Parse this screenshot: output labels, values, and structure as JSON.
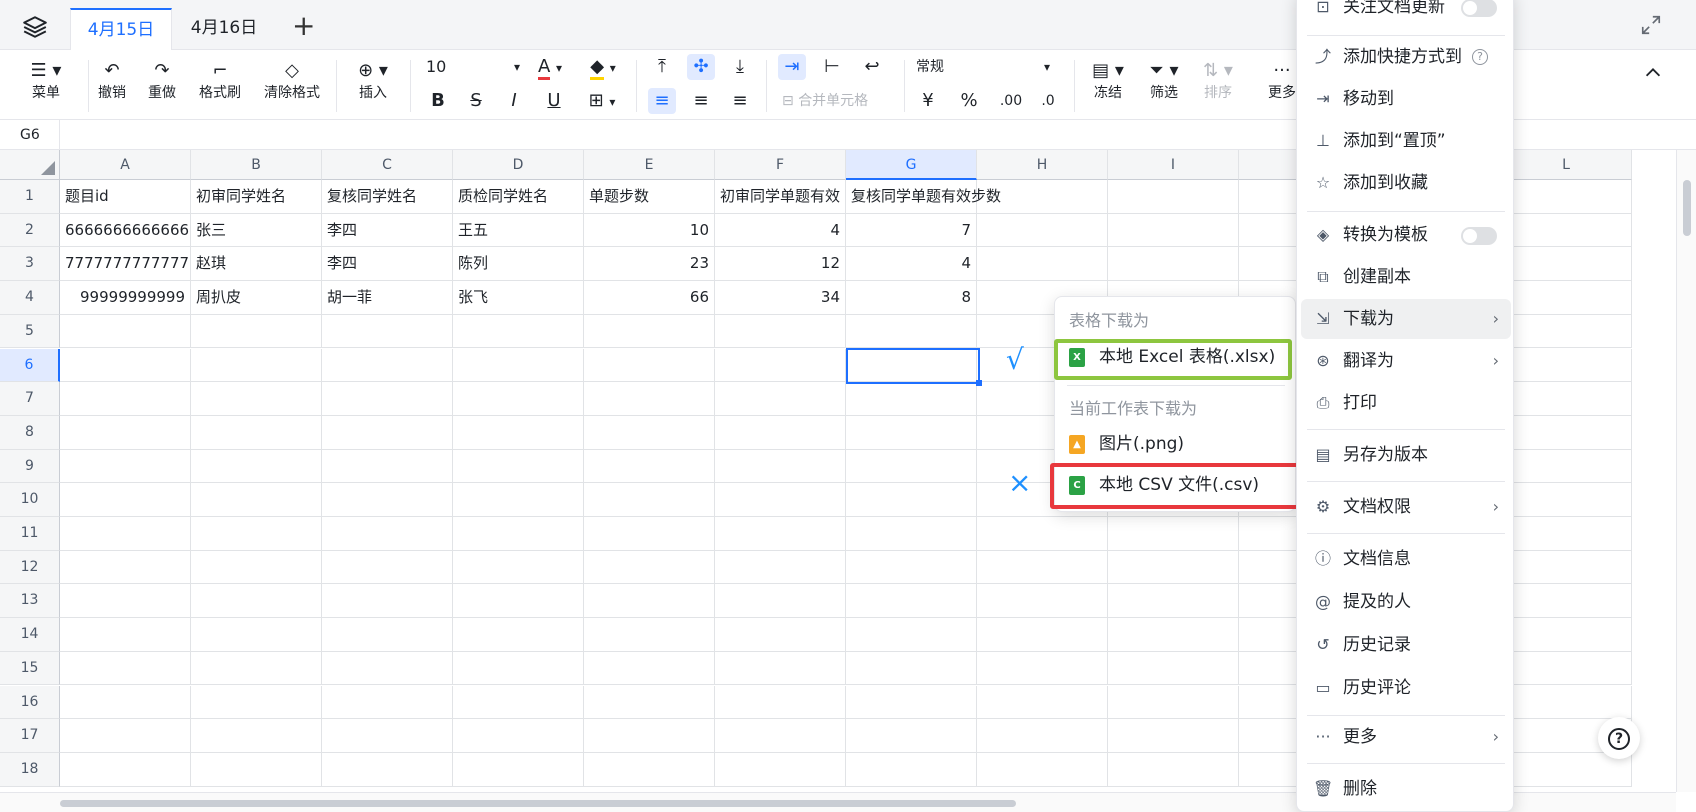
{
  "tabs": [
    {
      "label": "4月15日",
      "active": true
    },
    {
      "label": "4月16日",
      "active": false
    }
  ],
  "toolbar": {
    "menu": "菜单",
    "undo": "撤销",
    "redo": "重做",
    "format_painter": "格式刷",
    "clear_format": "清除格式",
    "insert": "插入",
    "font_size": "10",
    "number_format": "常规",
    "merge_cells": "合并单元格",
    "freeze": "冻结",
    "filter": "筛选",
    "sort": "排序",
    "more": "更多",
    "currency": "¥",
    "percent": "%",
    "dec_add": ".00",
    "dec_remove": ".0"
  },
  "cell_ref": "G6",
  "columns": [
    "A",
    "B",
    "C",
    "D",
    "E",
    "F",
    "G",
    "H",
    "I",
    "",
    "",
    "L"
  ],
  "rows": [
    "1",
    "2",
    "3",
    "4",
    "5",
    "6",
    "7",
    "8",
    "9",
    "10",
    "11",
    "12",
    "13",
    "14",
    "15",
    "16",
    "17",
    "18"
  ],
  "table": {
    "header": [
      "题目id",
      "初审同学姓名",
      "复核同学姓名",
      "质检同学姓名",
      "单题步数",
      "初审同学单题有效",
      "复核同学单题有效步数"
    ],
    "data": [
      [
        "6666666666666",
        "张三",
        "李四",
        "王五",
        "10",
        "4",
        "7"
      ],
      [
        "7777777777777",
        "赵琪",
        "李四",
        "陈列",
        "23",
        "12",
        "4"
      ],
      [
        "99999999999",
        "周扒皮",
        "胡一菲",
        "张飞",
        "66",
        "34",
        "8"
      ]
    ]
  },
  "side_menu": {
    "follow_updates": "关注文档更新",
    "add_shortcut": "添加快捷方式到",
    "move_to": "移动到",
    "pin_top": "添加到“置顶”",
    "add_favorite": "添加到收藏",
    "convert_template": "转换为模板",
    "create_copy": "创建副本",
    "download_as": "下载为",
    "translate_to": "翻译为",
    "print": "打印",
    "save_version": "另存为版本",
    "permissions": "文档权限",
    "doc_info": "文档信息",
    "mentioned": "提及的人",
    "history": "历史记录",
    "history_comments": "历史评论",
    "more": "更多",
    "delete": "删除"
  },
  "download_submenu": {
    "table_header": "表格下载为",
    "excel": "本地 Excel 表格(.xlsx)",
    "sheet_header": "当前工作表下载为",
    "png": "图片(.png)",
    "csv": "本地 CSV 文件(.csv)"
  },
  "annotations": {
    "check": "√",
    "cross": "×"
  },
  "colors": {
    "accent": "#1e6fff",
    "green_box": "#8dc63f",
    "red_box": "#e8383d",
    "excel": "#2ba245",
    "png": "#f5a623",
    "csv": "#2ba245"
  }
}
